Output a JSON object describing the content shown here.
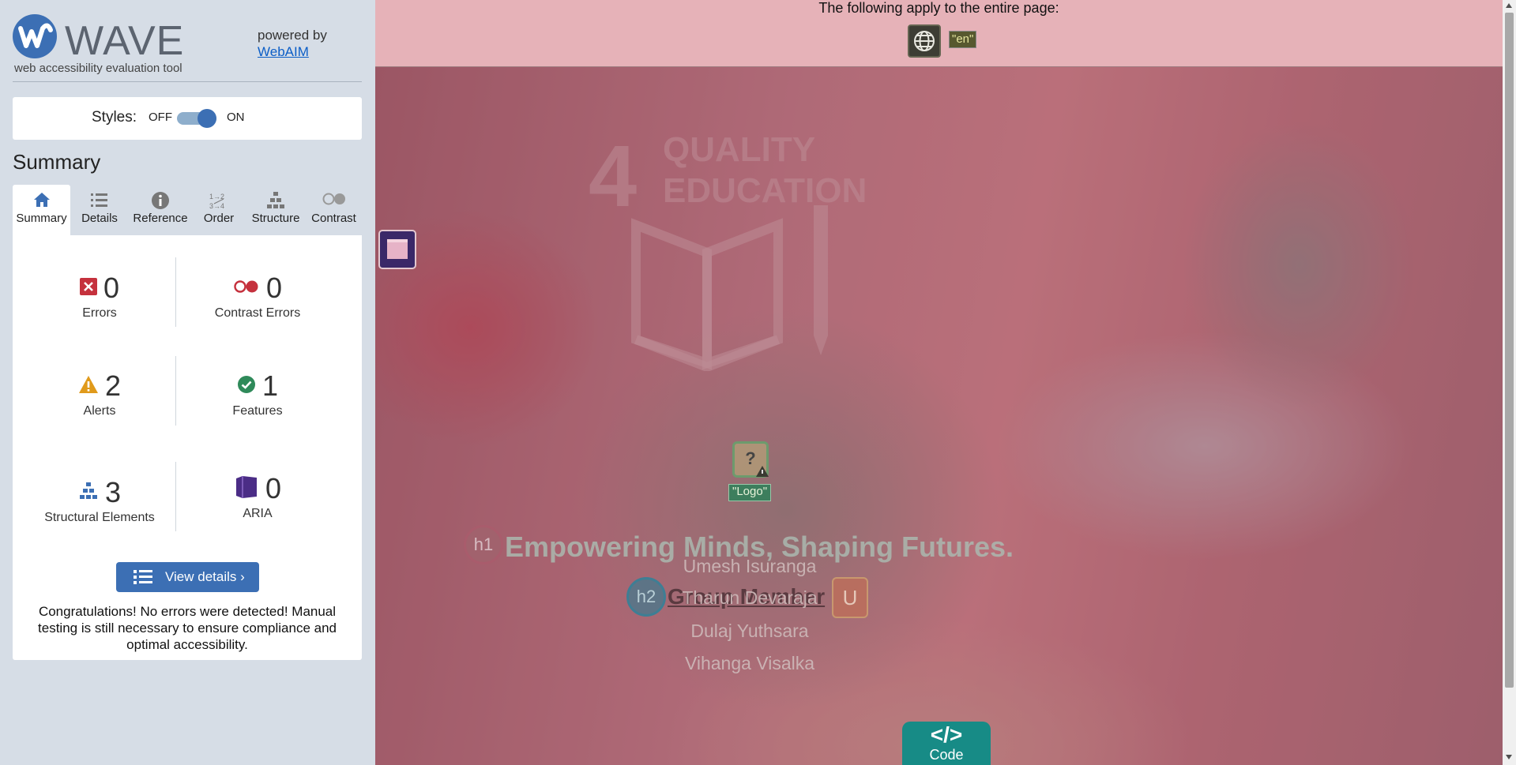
{
  "sidebar": {
    "logo_word": "WAVE",
    "logo_subtitle": "web accessibility evaluation tool",
    "powered_by": "powered by",
    "powered_link": "WebAIM",
    "styles_label": "Styles:",
    "styles_off": "OFF",
    "styles_on": "ON",
    "styles_enabled": true,
    "summary_title": "Summary",
    "tabs": [
      {
        "label": "Summary",
        "icon": "home-icon",
        "active": true
      },
      {
        "label": "Details",
        "icon": "list-icon",
        "active": false
      },
      {
        "label": "Reference",
        "icon": "info-icon",
        "active": false
      },
      {
        "label": "Order",
        "icon": "order-icon",
        "active": false
      },
      {
        "label": "Structure",
        "icon": "structure-icon",
        "active": false
      },
      {
        "label": "Contrast",
        "icon": "contrast-icon",
        "active": false
      }
    ],
    "stats": {
      "errors": {
        "count": "0",
        "label": "Errors",
        "color": "#d0021b"
      },
      "contrast": {
        "count": "0",
        "label": "Contrast Errors",
        "color": "#d0021b"
      },
      "alerts": {
        "count": "2",
        "label": "Alerts",
        "color": "#e8a317"
      },
      "features": {
        "count": "1",
        "label": "Features",
        "color": "#2e8b57"
      },
      "structure": {
        "count": "3",
        "label": "Structural Elements",
        "color": "#3c6fb4"
      },
      "aria": {
        "count": "0",
        "label": "ARIA",
        "color": "#5b3a8e"
      }
    },
    "view_details_label": "View details ›",
    "congrats_text": "Congratulations! No errors were detected! Manual testing is still necessary to ensure compliance and optimal accessibility."
  },
  "main": {
    "topbar_text": "The following apply to the entire page:",
    "lang_tag": "\"en\"",
    "quality_number": "4",
    "quality_line1": "QUALITY",
    "quality_line2": "EDUCATION",
    "logo_tag": "\"Logo\"",
    "logo_icon_glyph": "?",
    "h1_badge": "h1",
    "h1_text": "Empowering Minds, Shaping Futures.",
    "h2_badge": "h2",
    "h2_text": "Group Member",
    "u_badge": "U",
    "members": [
      "Umesh Isuranga",
      "Tharun Devaraja",
      "Dulaj Yuthsara",
      "Vihanga Visalka"
    ],
    "code_symbol": "</>",
    "code_label": "Code"
  },
  "colors": {
    "accent": "#3c6fb4",
    "sidebar_bg": "#d6dde6",
    "topbar_bg": "#e6b2b8",
    "code_btn": "#178b86"
  }
}
